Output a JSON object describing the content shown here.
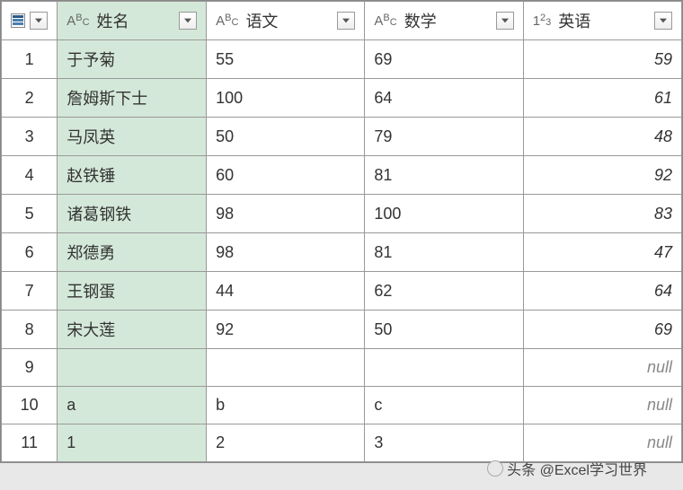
{
  "columns": {
    "rowNumHeader": "",
    "name": "姓名",
    "chinese": "语文",
    "math": "数学",
    "english": "英语"
  },
  "typeIcons": {
    "text": "ABC",
    "number": "123"
  },
  "rows": [
    {
      "num": "1",
      "name": "于予菊",
      "chinese": "55",
      "math": "69",
      "english": "59",
      "englishNull": false
    },
    {
      "num": "2",
      "name": "詹姆斯下士",
      "chinese": "100",
      "math": "64",
      "english": "61",
      "englishNull": false
    },
    {
      "num": "3",
      "name": "马凤英",
      "chinese": "50",
      "math": "79",
      "english": "48",
      "englishNull": false
    },
    {
      "num": "4",
      "name": "赵铁锤",
      "chinese": "60",
      "math": "81",
      "english": "92",
      "englishNull": false
    },
    {
      "num": "5",
      "name": "诸葛钢铁",
      "chinese": "98",
      "math": "100",
      "english": "83",
      "englishNull": false
    },
    {
      "num": "6",
      "name": "郑德勇",
      "chinese": "98",
      "math": "81",
      "english": "47",
      "englishNull": false
    },
    {
      "num": "7",
      "name": "王钢蛋",
      "chinese": "44",
      "math": "62",
      "english": "64",
      "englishNull": false
    },
    {
      "num": "8",
      "name": "宋大莲",
      "chinese": "92",
      "math": "50",
      "english": "69",
      "englishNull": false
    },
    {
      "num": "9",
      "name": "",
      "chinese": "",
      "math": "",
      "english": "null",
      "englishNull": true
    },
    {
      "num": "10",
      "name": "a",
      "chinese": "b",
      "math": "c",
      "english": "null",
      "englishNull": true
    },
    {
      "num": "11",
      "name": "1",
      "chinese": "2",
      "math": "3",
      "english": "null",
      "englishNull": true
    }
  ],
  "watermark": "头条 @Excel学习世界"
}
